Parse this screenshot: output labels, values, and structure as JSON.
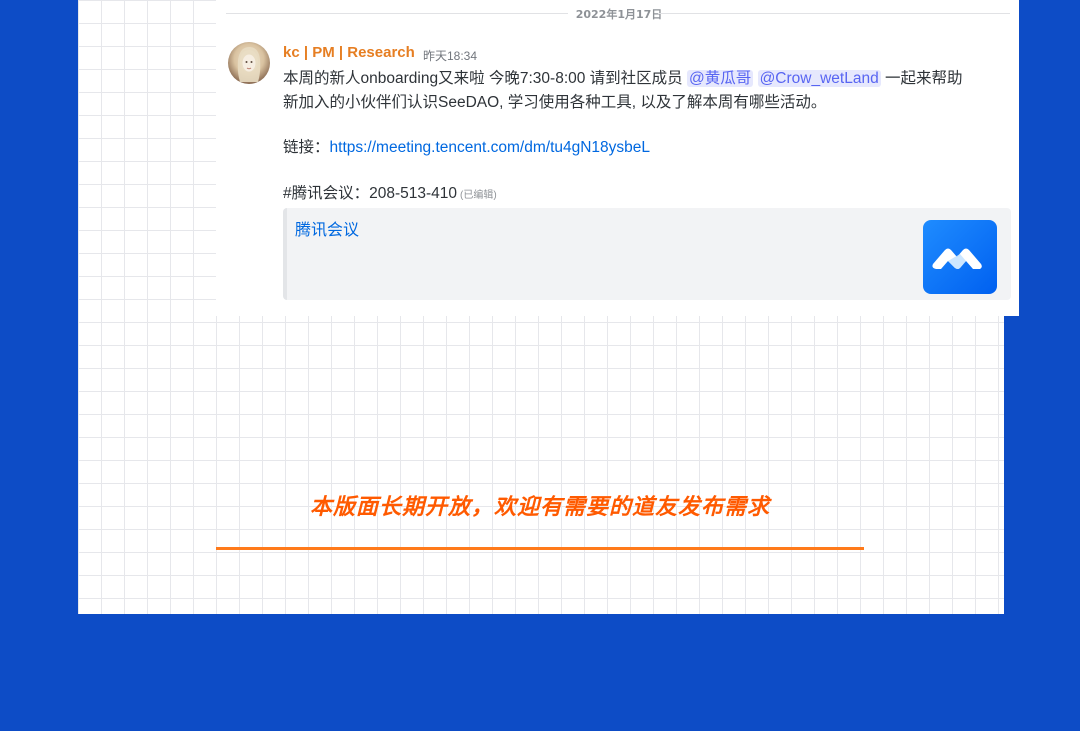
{
  "chat": {
    "date_divider": "2022年1月17日",
    "message": {
      "author": "kc | PM | Research",
      "timestamp": "昨天18:34",
      "line1_text": "本周的新人onboarding又来啦 今晚7:30-8:00 请到社区成员 ",
      "mention1": "@黄瓜哥",
      "mention2": "@Crow_wetLand",
      "line1_tail": " 一起来帮助",
      "line2_text": "新加入的小伙伴们认识SeeDAO, 学习使用各种工具, 以及了解本周有哪些活动。",
      "link_label": "链接：",
      "link_url": "https://meeting.tencent.com/dm/tu4gN18ysbeL",
      "meeting_label": "#腾讯会议：208-513-410",
      "edited": "(已编辑)",
      "embed_title": "腾讯会议",
      "embed_icon": "tencent-meeting-logo-icon"
    }
  },
  "notice": {
    "text": "本版面长期开放，欢迎有需要的道友发布需求"
  },
  "colors": {
    "background": "#0d4cc6",
    "author": "#e67e22",
    "link": "#0068e0",
    "mention": "#5865f2",
    "notice": "#ff5a00"
  }
}
